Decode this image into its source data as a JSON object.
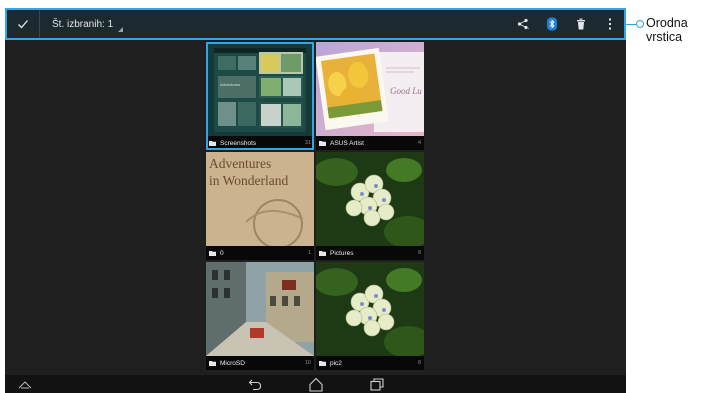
{
  "action_bar": {
    "selection_label": "Št. izbranih: 1",
    "icons": [
      "checkmark-icon",
      "share-icon",
      "bluetooth-icon",
      "trash-icon",
      "overflow-menu-icon"
    ]
  },
  "albums": [
    {
      "name": "Screenshots",
      "count": "31",
      "selected": true
    },
    {
      "name": "ASUS Artist",
      "count": "4",
      "selected": false
    },
    {
      "name": "0",
      "count": "1",
      "selected": false,
      "image_text": [
        "Adventures",
        "in Wonderland"
      ]
    },
    {
      "name": "Pictures",
      "count": "8",
      "selected": false
    },
    {
      "name": "MicroSD",
      "count": "10",
      "selected": false
    },
    {
      "name": "pic2",
      "count": "8",
      "selected": false
    }
  ],
  "artist_note_text": "Good Lu",
  "callout": {
    "line1": "Orodna",
    "line2": "vrstica"
  },
  "nav_bar": {
    "icons": [
      "recents-up-icon",
      "back-icon",
      "home-icon",
      "recent-apps-icon"
    ]
  },
  "colors": {
    "accent": "#30a6e6",
    "action_bar_bg": "#1c2a30",
    "screen_bg": "#1f1f1f"
  }
}
